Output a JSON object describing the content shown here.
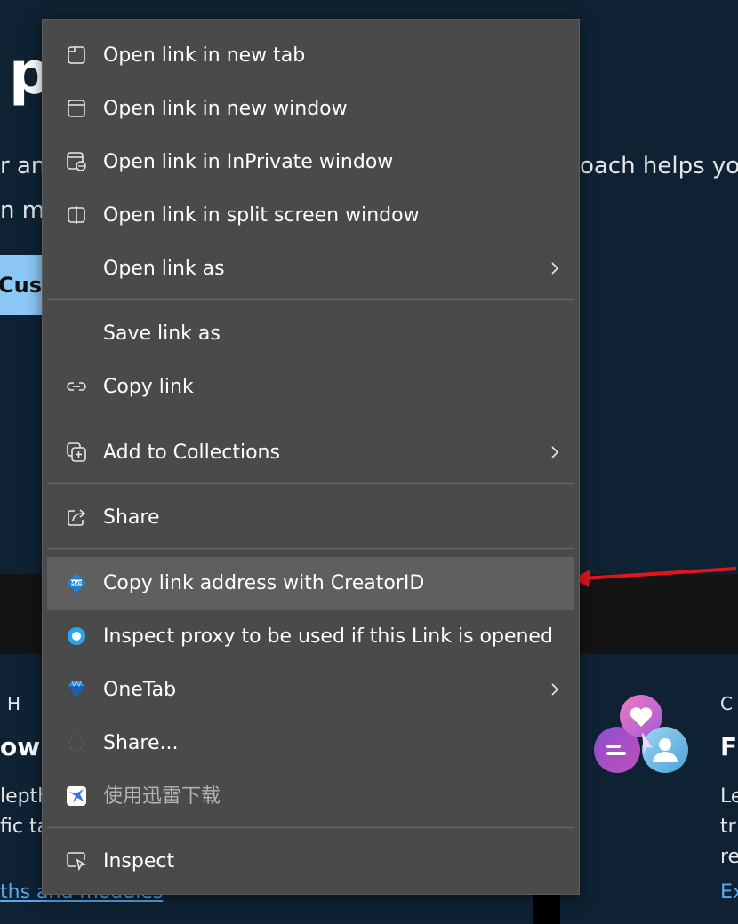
{
  "background": {
    "big_letter": "p",
    "line1_left": "r an",
    "line2_left": "n mo",
    "line1_right": "oach helps you",
    "cta_text": "Custo",
    "section_left_label": "H S",
    "section_left_heading": "ow",
    "section_left_line1": "lepth",
    "section_left_line2": "fic ta",
    "section_left_link": "ths and modules",
    "section_right_label": "C",
    "section_right_heading": "Fi",
    "section_right_line1": "Le",
    "section_right_line2": "tr",
    "section_right_line3": "re",
    "section_right_link": "Ex"
  },
  "menu": {
    "items": [
      {
        "label": "Open link in new tab",
        "icon": "new-tab-icon"
      },
      {
        "label": "Open link in new window",
        "icon": "new-window-icon"
      },
      {
        "label": "Open link in InPrivate window",
        "icon": "inprivate-icon"
      },
      {
        "label": "Open link in split screen window",
        "icon": "split-screen-icon"
      },
      {
        "label": "Open link as",
        "icon": "",
        "submenu": true
      },
      {
        "label": "Save link as",
        "icon": ""
      },
      {
        "label": "Copy link",
        "icon": "link-icon"
      },
      {
        "label": "Add to Collections",
        "icon": "collections-icon",
        "submenu": true
      },
      {
        "label": "Share",
        "icon": "share-icon"
      },
      {
        "label": "Copy link address with CreatorID",
        "icon": "mvp-icon",
        "highlighted": true
      },
      {
        "label": "Inspect proxy to be used if this Link is opened",
        "icon": "proxy-circle-icon"
      },
      {
        "label": "OneTab",
        "icon": "onetab-icon",
        "submenu": true
      },
      {
        "label": "Share...",
        "icon": "share-extension-icon"
      },
      {
        "label": "使用迅雷下载",
        "icon": "thunder-icon",
        "disabled": true
      },
      {
        "label": "Inspect",
        "icon": "inspect-icon"
      }
    ]
  },
  "colors": {
    "menu_bg": "#4a4a4a",
    "highlight_bg": "#5f5f5f",
    "page_bg": "#0e2233",
    "arrow": "#e0161c",
    "link": "#5aa9ee"
  }
}
